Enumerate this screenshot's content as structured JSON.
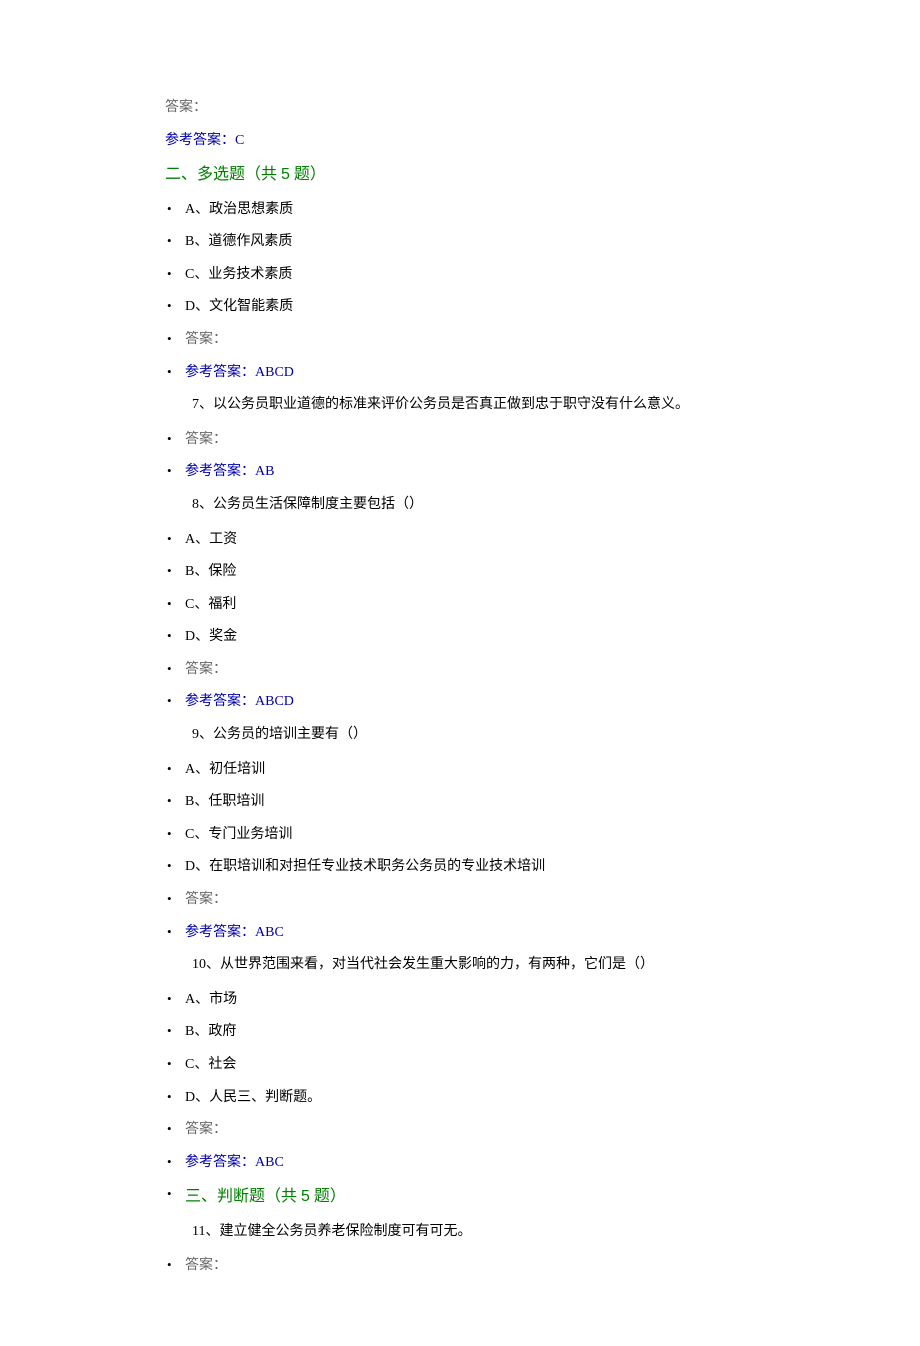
{
  "initialAnswerLabel": "答案：",
  "initialRefAnswer": "参考答案：C",
  "section2": {
    "title_prefix": "二、多选题（共 ",
    "title_count": "5",
    "title_suffix": " 题）"
  },
  "section3": {
    "title_prefix": "三、判断题（共 ",
    "title_count": "5",
    "title_suffix": " 题）"
  },
  "q6": {
    "optA": "A、政治思想素质",
    "optB": "B、道德作风素质",
    "optC": "C、业务技术素质",
    "optD": "D、文化智能素质",
    "answerLabel": "答案：",
    "refAnswer": "参考答案：ABCD"
  },
  "q7": {
    "question": "7、以公务员职业道德的标准来评价公务员是否真正做到忠于职守没有什么意义。",
    "answerLabel": "答案：",
    "refAnswer": "参考答案：AB"
  },
  "q8": {
    "question": "8、公务员生活保障制度主要包括（）",
    "optA": "A、工资",
    "optB": "B、保险",
    "optC": "C、福利",
    "optD": "D、奖金",
    "answerLabel": "答案：",
    "refAnswer": "参考答案：ABCD"
  },
  "q9": {
    "question": "9、公务员的培训主要有（）",
    "optA": "A、初任培训",
    "optB": "B、任职培训",
    "optC": "C、专门业务培训",
    "optD": "D、在职培训和对担任专业技术职务公务员的专业技术培训",
    "answerLabel": "答案：",
    "refAnswer": "参考答案：ABC"
  },
  "q10": {
    "question": "10、从世界范围来看，对当代社会发生重大影响的力，有两种，它们是（）",
    "optA": "A、市场",
    "optB": "B、政府",
    "optC": "C、社会",
    "optD": "D、人民三、判断题。",
    "answerLabel": "答案：",
    "refAnswer": "参考答案：ABC"
  },
  "q11": {
    "question": "11、建立健全公务员养老保险制度可有可无。",
    "answerLabel": "答案："
  }
}
